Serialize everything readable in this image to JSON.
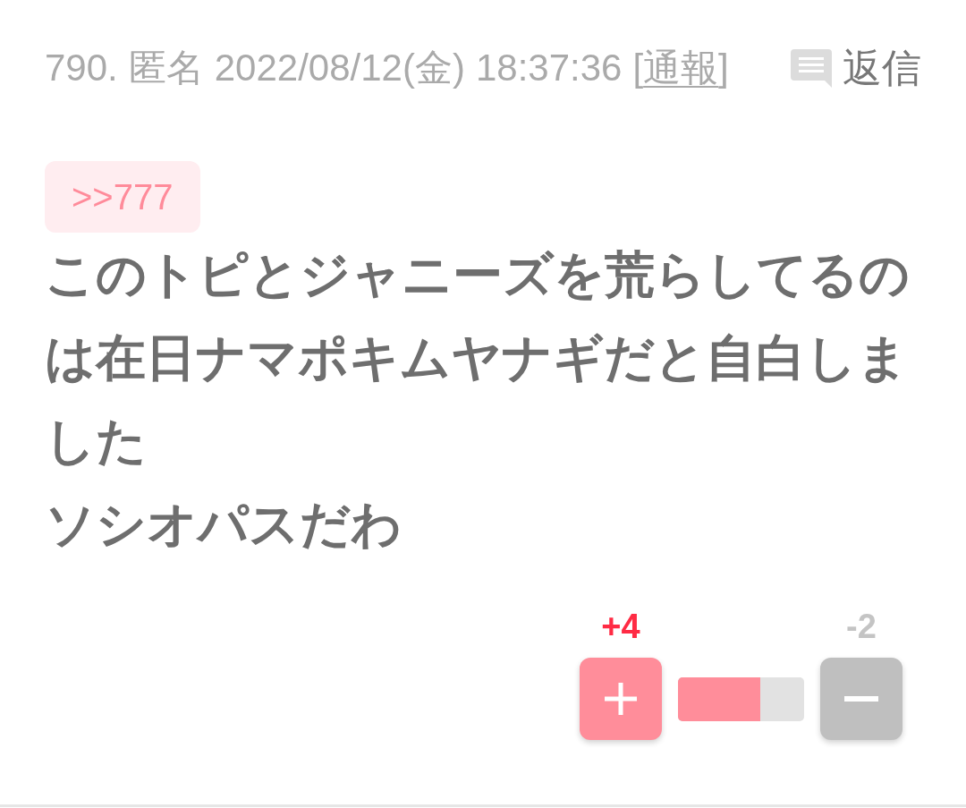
{
  "post": {
    "number": "790.",
    "author": "匿名",
    "date": "2022/08/12(金)",
    "time": "18:37:36",
    "report_link": {
      "bracket_open": "[",
      "label": "通報",
      "bracket_close": "]"
    },
    "reply_button": {
      "label": "返信"
    }
  },
  "anchor": ">>777",
  "body_paragraphs": [
    "このトピとジャニーズを荒らしてるのは在日ナマポキムヤナギだと自白しました",
    "ソシオパスだわ"
  ],
  "votes": {
    "plus": {
      "count": "+4"
    },
    "minus": {
      "count": "-2"
    },
    "level": 0.65
  }
}
